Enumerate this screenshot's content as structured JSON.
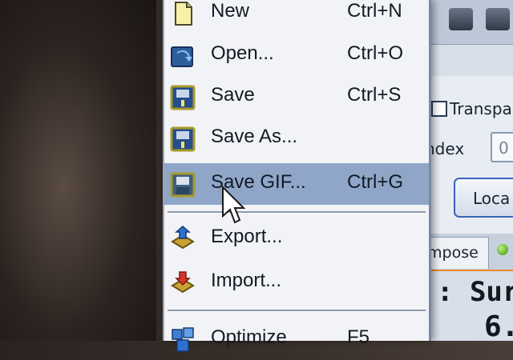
{
  "menu": {
    "items": [
      {
        "label": "New",
        "shortcut": "Ctrl+N",
        "icon": "new-file-icon"
      },
      {
        "label": "Open...",
        "shortcut": "Ctrl+O",
        "icon": "open-folder-icon"
      },
      {
        "label": "Save",
        "shortcut": "Ctrl+S",
        "icon": "save-icon"
      },
      {
        "label": "Save As...",
        "shortcut": "",
        "icon": "save-as-icon"
      },
      {
        "label": "Save GIF...",
        "shortcut": "Ctrl+G",
        "icon": "save-gif-icon"
      },
      {
        "label": "Export...",
        "shortcut": "",
        "icon": "export-icon"
      },
      {
        "label": "Import...",
        "shortcut": "",
        "icon": "import-icon"
      },
      {
        "label": "Optimize",
        "shortcut": "F5",
        "icon": "optimize-icon"
      }
    ],
    "selected_index": 4,
    "highlight_color": "#8fa6c9"
  },
  "right_panel": {
    "checkbox_label": "Transpa",
    "index_label": "ndex",
    "index_value": "0",
    "button_label": "Loca",
    "tab_label": "mpose",
    "status_text": ": Sur",
    "status_number": "6."
  }
}
